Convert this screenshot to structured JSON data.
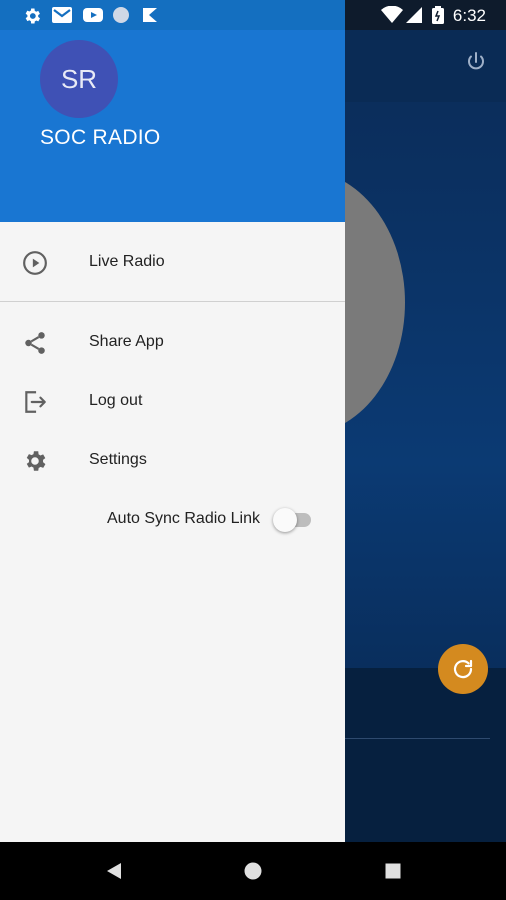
{
  "status_bar": {
    "time": "6:32",
    "left_icons": [
      "gear-icon",
      "gmail-icon",
      "youtube-icon",
      "circle-icon",
      "notification-icon"
    ],
    "right_icons": [
      "wifi-icon",
      "cellular-icon",
      "battery-icon"
    ]
  },
  "drawer": {
    "avatar_initials": "SR",
    "app_name": "SOC RADIO",
    "items": [
      {
        "label": "Live Radio",
        "icon": "play-circle-icon"
      },
      {
        "label": "Share App",
        "icon": "share-icon"
      },
      {
        "label": "Log out",
        "icon": "logout-icon"
      },
      {
        "label": "Settings",
        "icon": "gear-icon"
      }
    ],
    "auto_sync": {
      "label": "Auto Sync Radio Link",
      "enabled": false
    }
  },
  "colors": {
    "header": "#1976d2",
    "avatar": "#3f51b5",
    "fab": "#d48a1f"
  },
  "navigation": [
    "back-icon",
    "home-icon",
    "recents-icon"
  ]
}
